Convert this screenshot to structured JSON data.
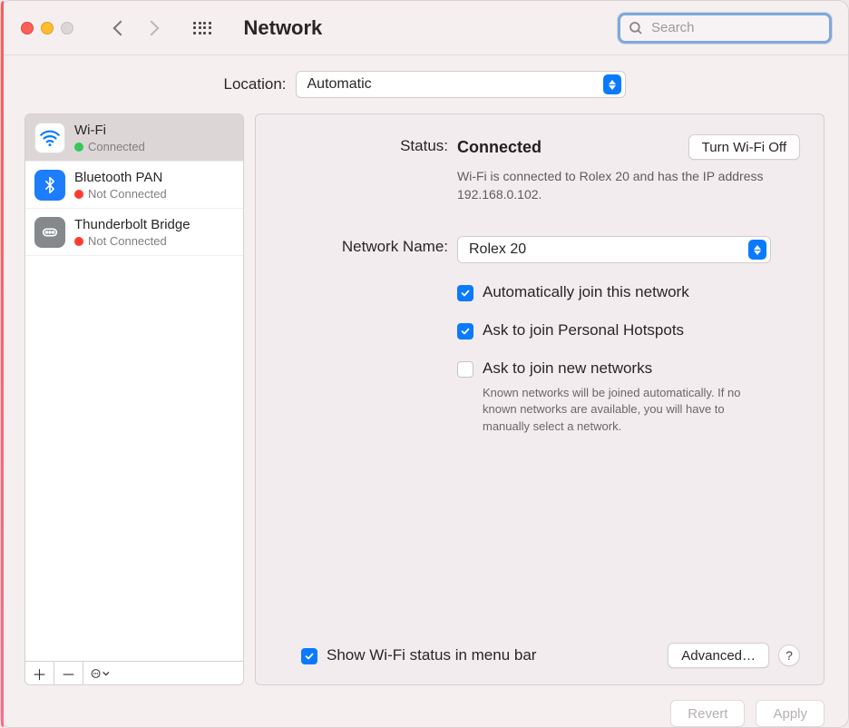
{
  "toolbar": {
    "title": "Network",
    "search_placeholder": "Search"
  },
  "location": {
    "label": "Location:",
    "selected": "Automatic"
  },
  "sidebar": {
    "items": [
      {
        "name": "Wi-Fi",
        "status": "Connected",
        "status_variant": "green",
        "icon": "wifi",
        "selected": true
      },
      {
        "name": "Bluetooth PAN",
        "status": "Not Connected",
        "status_variant": "red",
        "icon": "bt",
        "selected": false
      },
      {
        "name": "Thunderbolt Bridge",
        "status": "Not Connected",
        "status_variant": "red",
        "icon": "tb",
        "selected": false
      }
    ]
  },
  "details": {
    "status_label": "Status:",
    "status_value": "Connected",
    "toggle_button": "Turn Wi-Fi Off",
    "status_message": "Wi-Fi is connected to Rolex 20 and has the IP address 192.168.0.102.",
    "network_name_label": "Network Name:",
    "network_name_value": "Rolex 20",
    "auto_join_label": "Automatically join this network",
    "auto_join_checked": true,
    "ask_hotspots_label": "Ask to join Personal Hotspots",
    "ask_hotspots_checked": true,
    "ask_new_label": "Ask to join new networks",
    "ask_new_checked": false,
    "ask_new_help": "Known networks will be joined automatically. If no known networks are available, you will have to manually select a network.",
    "show_menubar_label": "Show Wi-Fi status in menu bar",
    "show_menubar_checked": true,
    "advanced_button": "Advanced…"
  },
  "footer": {
    "revert": "Revert",
    "apply": "Apply"
  }
}
